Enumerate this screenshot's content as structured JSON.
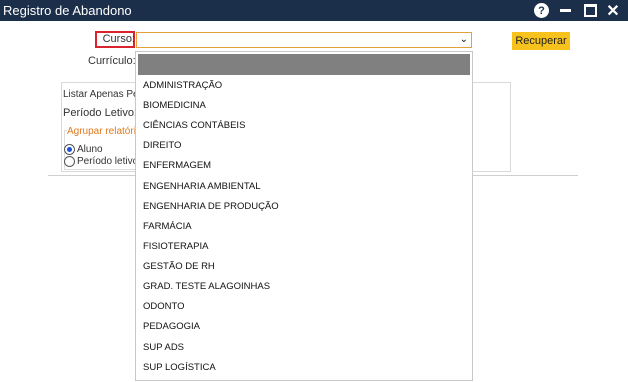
{
  "window": {
    "title": "Registro de Abandono"
  },
  "form": {
    "curso_label": "Curso:",
    "curriculo_label": "Currículo:",
    "recuperar_label": "Recuperar",
    "listar_label": "Listar Apenas Perío",
    "periodo_letivo_label": "Período Letivo:",
    "agrupar_label": "Agrupar relatório",
    "radio_aluno": "Aluno",
    "radio_periodo": "Período letivo",
    "curso_value": ""
  },
  "dropdown": {
    "items": [
      "ADMINISTRAÇÃO",
      "BIOMEDICINA",
      "CIÊNCIAS CONTÁBEIS",
      "DIREITO",
      "ENFERMAGEM",
      "ENGENHARIA AMBIENTAL",
      "ENGENHARIA DE PRODUÇÃO",
      "FARMÁCIA",
      "FISIOTERAPIA",
      "GESTÃO DE RH",
      "GRAD. TESTE ALAGOINHAS",
      "ODONTO",
      "PEDAGOGIA",
      "SUP ADS",
      "SUP LOGÍSTICA"
    ]
  },
  "colors": {
    "titlebar": "#1c2f4a",
    "accent_button": "#f7c21b",
    "highlight_border": "#d9232d",
    "select_border": "#e3a33a",
    "group_label": "#e07a1f"
  },
  "icons": [
    "help-icon",
    "minimize-icon",
    "maximize-icon",
    "close-icon",
    "chevron-down-icon"
  ]
}
